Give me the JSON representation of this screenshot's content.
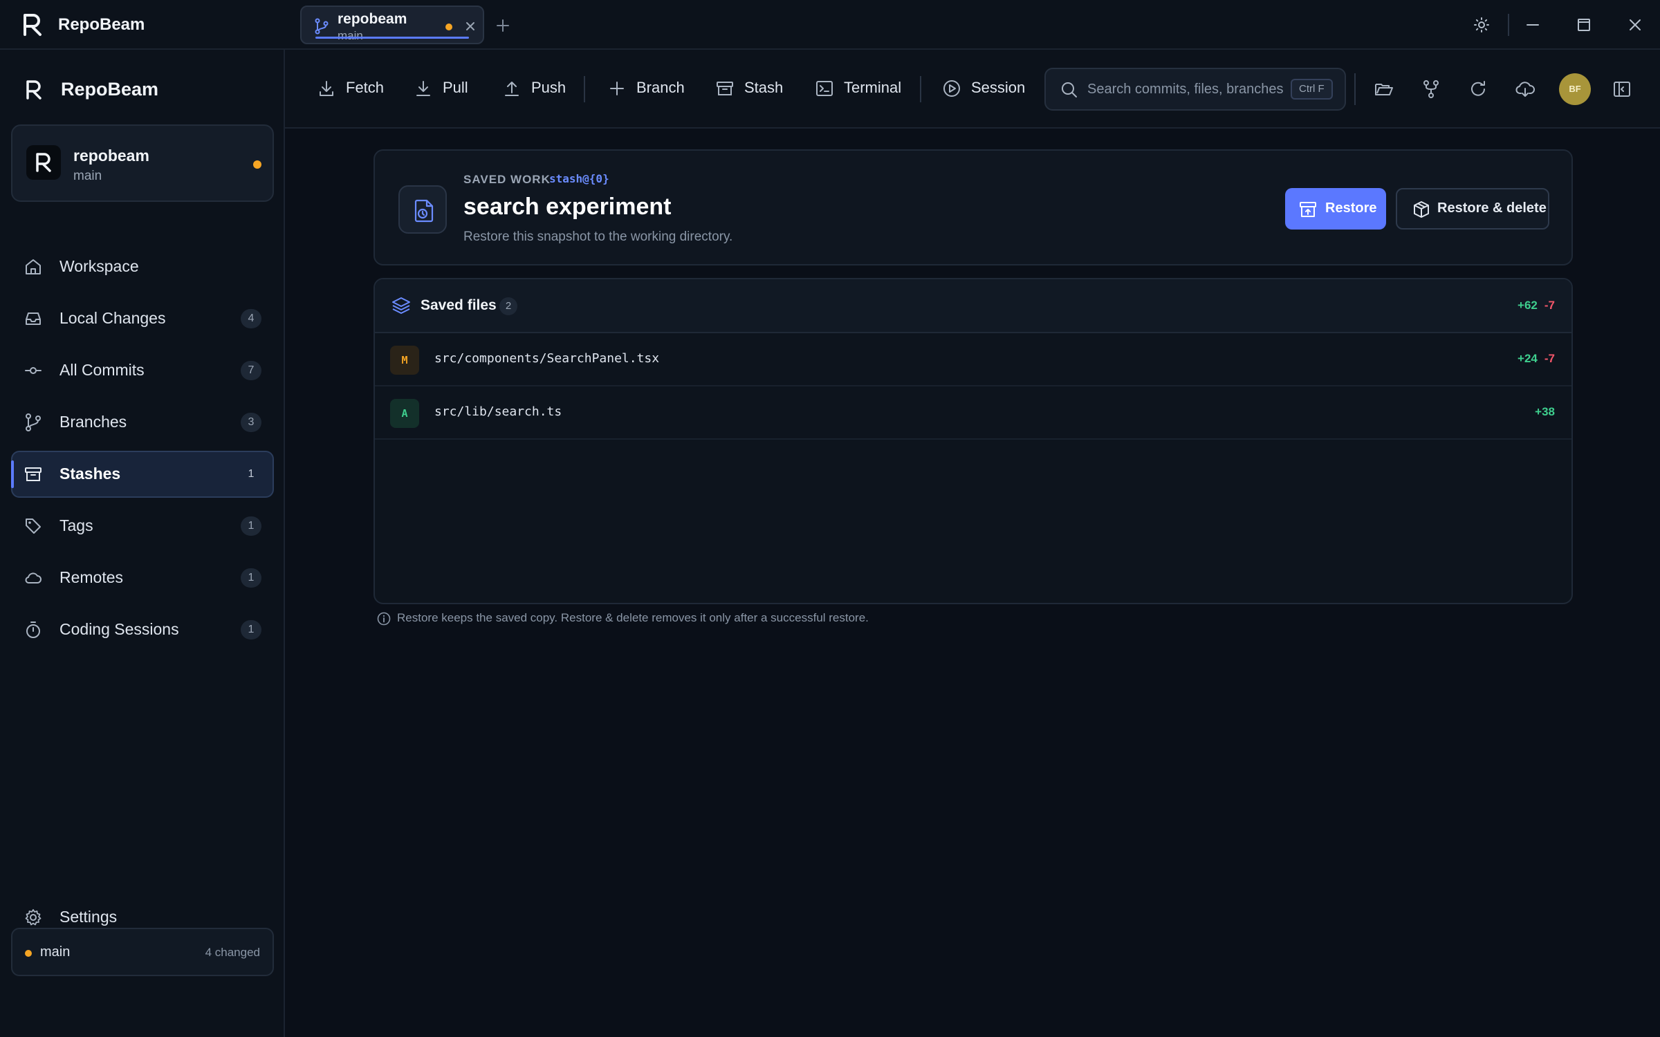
{
  "app": {
    "name": "RepoBeam"
  },
  "tab": {
    "title": "repobeam",
    "subtitle": "main",
    "has_changes": true
  },
  "sidebar": {
    "brand": "RepoBeam",
    "repo": {
      "name": "repobeam",
      "branch": "main"
    },
    "items": [
      {
        "label": "Workspace",
        "badge": null,
        "icon": "home-icon"
      },
      {
        "label": "Local Changes",
        "badge": "4",
        "icon": "inbox-icon"
      },
      {
        "label": "All Commits",
        "badge": "7",
        "icon": "commit-icon"
      },
      {
        "label": "Branches",
        "badge": "3",
        "icon": "git-branch-icon"
      },
      {
        "label": "Stashes",
        "badge": "1",
        "icon": "archive-icon",
        "active": true
      },
      {
        "label": "Tags",
        "badge": "1",
        "icon": "tag-icon"
      },
      {
        "label": "Remotes",
        "badge": "1",
        "icon": "cloud-icon"
      },
      {
        "label": "Coding Sessions",
        "badge": "1",
        "icon": "timer-icon"
      }
    ],
    "settings_label": "Settings",
    "status": {
      "branch": "main",
      "changed": "4 changed"
    }
  },
  "toolbar": {
    "fetch": "Fetch",
    "pull": "Pull",
    "push": "Push",
    "branch": "Branch",
    "stash": "Stash",
    "terminal": "Terminal",
    "session": "Session",
    "search_placeholder": "Search commits, files, branches",
    "search_shortcut": "Ctrl F",
    "user_initials": "BF"
  },
  "stash": {
    "eyebrow": "SAVED WORK",
    "ref": "stash@{0}",
    "title": "search experiment",
    "description": "Restore this snapshot to the working directory.",
    "restore_label": "Restore",
    "restore_delete_label": "Restore & delete"
  },
  "files": {
    "title": "Saved files",
    "count": "2",
    "total_additions": "+62",
    "total_deletions": "-7",
    "rows": [
      {
        "status": "M",
        "path": "src/components/SearchPanel.tsx",
        "additions": "+24",
        "deletions": "-7"
      },
      {
        "status": "A",
        "path": "src/lib/search.ts",
        "additions": "+38",
        "deletions": ""
      }
    ]
  },
  "note": "Restore keeps the saved copy. Restore & delete removes it only after a successful restore.",
  "colors": {
    "accent": "#5b78ff",
    "modified": "#f5a524",
    "added": "#3ecf8e",
    "deleted": "#f4566a",
    "background": "#0a0f18"
  }
}
